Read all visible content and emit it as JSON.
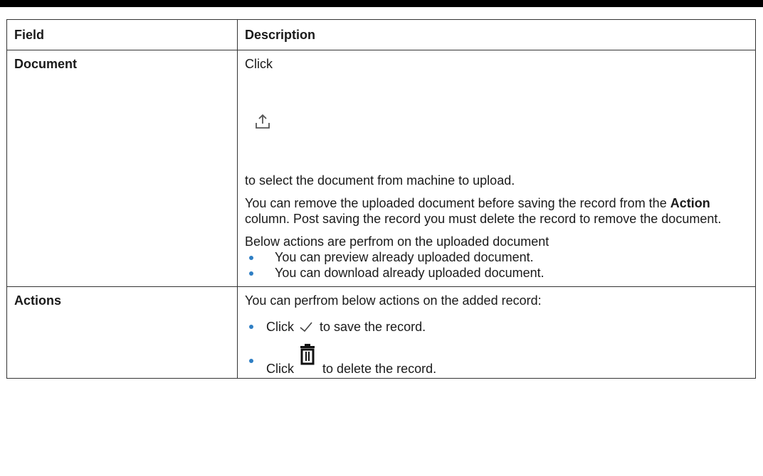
{
  "table": {
    "headers": [
      "Field",
      "Description"
    ],
    "rows": {
      "document": {
        "field": "Document",
        "click": "Click",
        "after_icon": "to select the document from machine to upload.",
        "para2_a": "You can remove the uploaded document before saving the record from the ",
        "para2_bold": "Action",
        "para2_b": " column. Post saving the record you must delete the record to remove the document.",
        "para3": "Below actions are perfrom on the uploaded document",
        "bullets": [
          "You can preview already uploaded document.",
          "You can download already uploaded document."
        ]
      },
      "actions": {
        "field": "Actions",
        "intro": "You can perfrom below actions on the added record:",
        "save_click": "Click",
        "save_text": "to save the record.",
        "delete_click": "Click",
        "delete_text": "to delete the record."
      }
    }
  },
  "icons": {
    "upload": "upload-icon",
    "save": "checkmark-icon",
    "delete": "trash-icon",
    "bullet_color": "#2f7fc4"
  }
}
